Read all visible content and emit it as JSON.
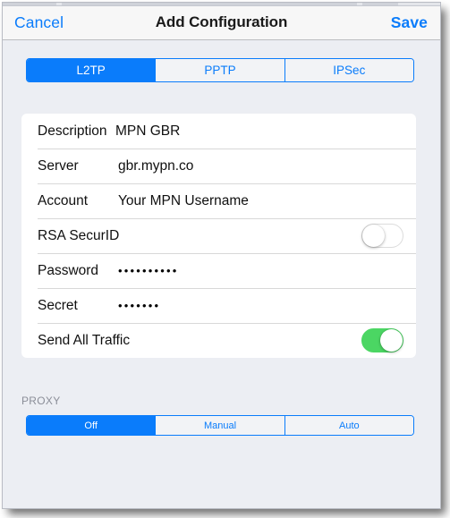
{
  "navbar": {
    "cancel_label": "Cancel",
    "title": "Add Configuration",
    "save_label": "Save"
  },
  "protocol_segmented": {
    "options": [
      "L2TP",
      "PPTP",
      "IPSec"
    ],
    "selected": "L2TP",
    "selected_index": 0
  },
  "form": {
    "rows": [
      {
        "label": "Description",
        "value": "MPN GBR",
        "type": "text"
      },
      {
        "label": "Server",
        "value": "gbr.mypn.co",
        "type": "text"
      },
      {
        "label": "Account",
        "value": "Your MPN Username",
        "type": "text"
      },
      {
        "label": "RSA SecurID",
        "value": "",
        "type": "switch",
        "switch_state": "off"
      },
      {
        "label": "Password",
        "value": "••••••••••",
        "type": "password"
      },
      {
        "label": "Secret",
        "value": "•••••••",
        "type": "password"
      },
      {
        "label": "Send All Traffic",
        "value": "",
        "type": "switch",
        "switch_state": "on"
      }
    ]
  },
  "proxy_section": {
    "header": "PROXY",
    "options": [
      "Off",
      "Manual",
      "Auto"
    ],
    "selected": "Off",
    "selected_index": 0
  },
  "colors": {
    "accent_blue": "#0a7cfb",
    "switch_on_green": "#4bd663",
    "page_background": "#eceef3",
    "card_background": "#ffffff",
    "navbar_background": "#f7f7f7",
    "section_header_gray": "#8b8e98"
  }
}
